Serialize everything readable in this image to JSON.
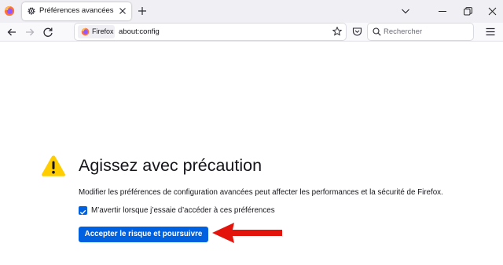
{
  "tab": {
    "title": "Préférences avancées"
  },
  "navbar": {
    "identity_label": "Firefox",
    "url": "about:config",
    "search_placeholder": "Rechercher"
  },
  "content": {
    "title": "Agissez avec précaution",
    "description": "Modifier les préférences de configuration avancées peut affecter les performances et la sécurité de Firefox.",
    "checkbox": {
      "label": "M’avertir lorsque j’essaie d’accéder à ces préférences",
      "checked": true
    },
    "accept_button": "Accepter le risque et poursuivre"
  },
  "colors": {
    "accent": "#0061e0",
    "warning": "#ffcd00",
    "annotation_arrow": "#e3140c"
  },
  "icons": [
    "firefox-logo-icon",
    "gear-icon",
    "close-icon",
    "plus-icon",
    "chevron-down-icon",
    "minimize-icon",
    "restore-icon",
    "back-icon",
    "forward-icon",
    "reload-icon",
    "star-icon",
    "pocket-icon",
    "search-icon",
    "hamburger-menu-icon",
    "warning-icon",
    "checkmark-icon",
    "red-arrow-icon"
  ]
}
